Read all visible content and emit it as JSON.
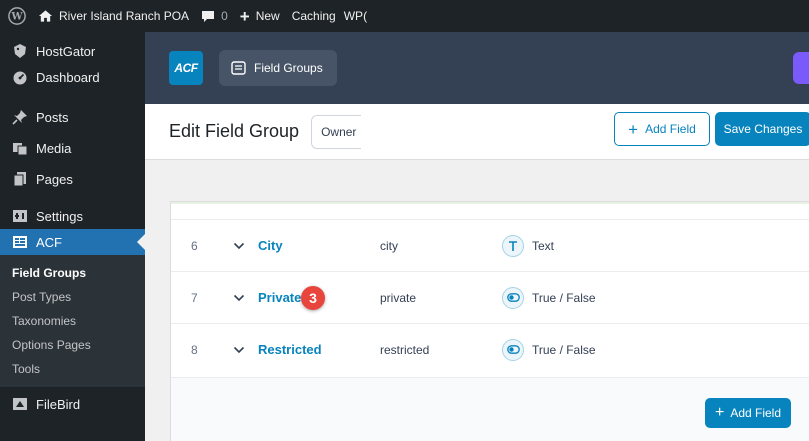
{
  "adminbar": {
    "site_name": "River Island Ranch POA",
    "comments_count": "0",
    "new_label": "New",
    "caching_label": "Caching",
    "wp_truncated": "WP("
  },
  "sidebar": {
    "items": [
      {
        "label": "HostGator",
        "icon": "hostgator-icon"
      },
      {
        "label": "Dashboard",
        "icon": "dashboard-icon"
      },
      {
        "label": "Posts",
        "icon": "pin-icon"
      },
      {
        "label": "Media",
        "icon": "media-icon"
      },
      {
        "label": "Pages",
        "icon": "pages-icon"
      },
      {
        "label": "Settings",
        "icon": "settings-icon"
      },
      {
        "label": "ACF",
        "icon": "acf-icon"
      },
      {
        "label": "FileBird",
        "icon": "filebird-icon"
      }
    ],
    "acf_submenu": [
      "Field Groups",
      "Post Types",
      "Taxonomies",
      "Options Pages",
      "Tools"
    ]
  },
  "acf_header": {
    "logo_text": "ACF",
    "tab_label": "Field Groups"
  },
  "titlebar": {
    "title": "Edit Field Group",
    "input_value": "Owner",
    "add_field_label": "Add Field",
    "save_label": "Save Changes"
  },
  "fields": [
    {
      "order": "6",
      "label": "City",
      "name": "city",
      "type": "Text",
      "type_icon": "text-type-icon"
    },
    {
      "order": "7",
      "label": "Private",
      "name": "private",
      "type": "True / False",
      "type_icon": "toggle-icon"
    },
    {
      "order": "8",
      "label": "Restricted",
      "name": "restricted",
      "type": "True / False",
      "type_icon": "toggle-icon"
    }
  ],
  "step_badge": "3",
  "footer": {
    "add_field_label": "Add Field"
  },
  "colors": {
    "accent": "#0783be",
    "admin_dark": "#1d2327",
    "acf_header": "#344054",
    "badge": "#e8453c"
  }
}
